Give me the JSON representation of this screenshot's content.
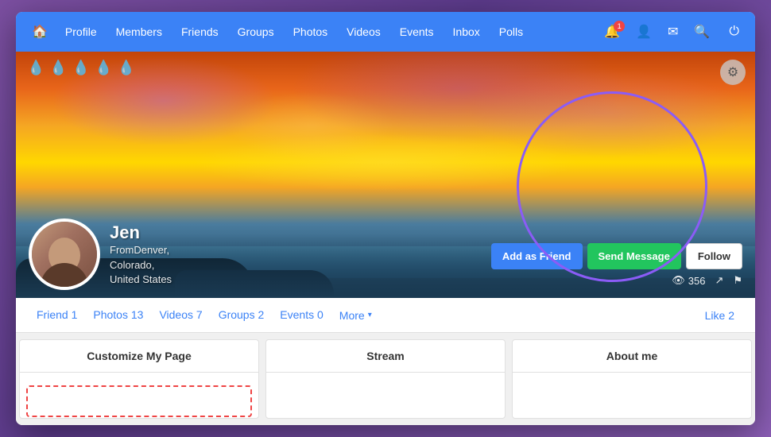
{
  "navbar": {
    "home_icon": "🏠",
    "items": [
      {
        "label": "Profile",
        "key": "profile"
      },
      {
        "label": "Members",
        "key": "members"
      },
      {
        "label": "Friends",
        "key": "friends"
      },
      {
        "label": "Groups",
        "key": "groups"
      },
      {
        "label": "Photos",
        "key": "photos"
      },
      {
        "label": "Videos",
        "key": "videos"
      },
      {
        "label": "Events",
        "key": "events"
      },
      {
        "label": "Inbox",
        "key": "inbox"
      },
      {
        "label": "Polls",
        "key": "polls"
      }
    ],
    "notification_count": "1",
    "icons": {
      "bell": "🔔",
      "user": "👤",
      "mail": "✉",
      "search": "🔍",
      "power": "⏻"
    }
  },
  "cover": {
    "gear_icon": "⚙",
    "water_drops": [
      "💧",
      "💧",
      "💧",
      "💧",
      "💧"
    ]
  },
  "profile": {
    "name": "Jen",
    "location_line1": "FromDenver,",
    "location_line2": "Colorado,",
    "location_line3": "United States"
  },
  "action_buttons": {
    "add_friend": "Add as Friend",
    "send_message": "Send Message",
    "follow": "Follow"
  },
  "stats": {
    "views_icon": "👁",
    "views_count": "356",
    "share_icon": "↗",
    "flag_icon": "⚑"
  },
  "profile_tabs": [
    {
      "label": "Friend",
      "count": "1"
    },
    {
      "label": "Photos",
      "count": "13"
    },
    {
      "label": "Videos",
      "count": "7"
    },
    {
      "label": "Groups",
      "count": "2"
    },
    {
      "label": "Events",
      "count": "0"
    },
    {
      "label": "More",
      "has_dropdown": true
    },
    {
      "label": "Like",
      "count": "2",
      "align": "right"
    }
  ],
  "panels": {
    "customize": {
      "title": "Customize My Page"
    },
    "stream": {
      "title": "Stream"
    },
    "about": {
      "title": "About me"
    }
  }
}
